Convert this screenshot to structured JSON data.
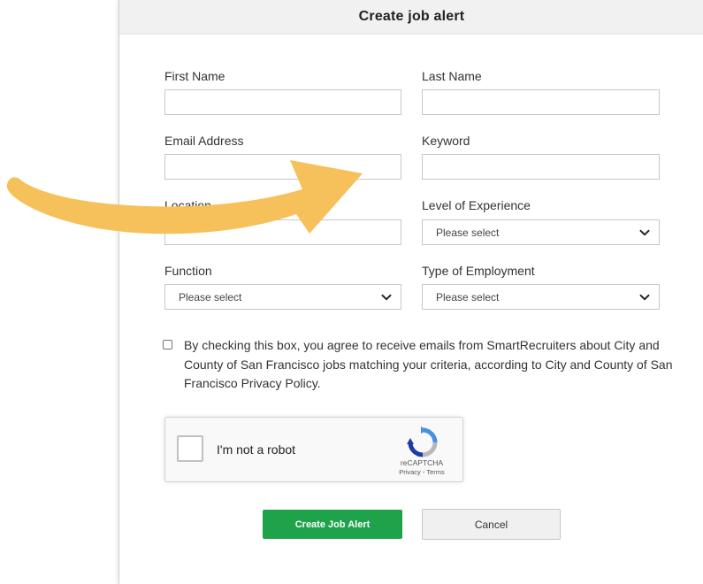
{
  "dialog": {
    "title": "Create job alert"
  },
  "form": {
    "first_name": {
      "label": "First Name",
      "value": ""
    },
    "last_name": {
      "label": "Last Name",
      "value": ""
    },
    "email": {
      "label": "Email Address",
      "value": ""
    },
    "keyword": {
      "label": "Keyword",
      "value": ""
    },
    "location": {
      "label": "Location",
      "value": ""
    },
    "experience": {
      "label": "Level of Experience",
      "selected": "Please select"
    },
    "function": {
      "label": "Function",
      "selected": "Please select"
    },
    "employment": {
      "label": "Type of Employment",
      "selected": "Please select"
    },
    "consent": {
      "text": "By checking this box, you agree to receive emails from SmartRecruiters about City and County of San Francisco jobs matching your criteria, according to City and County of San Francisco Privacy Policy.",
      "checked": false
    }
  },
  "recaptcha": {
    "label": "I'm not a robot",
    "brand": "reCAPTCHA",
    "privacy": "Privacy",
    "separator": " - ",
    "terms": "Terms"
  },
  "actions": {
    "create_label": "Create Job Alert",
    "cancel_label": "Cancel"
  },
  "colors": {
    "primary_button": "#1fa34a",
    "annotation_arrow": "#f6c05a",
    "header_background": "#f1f1f1"
  }
}
